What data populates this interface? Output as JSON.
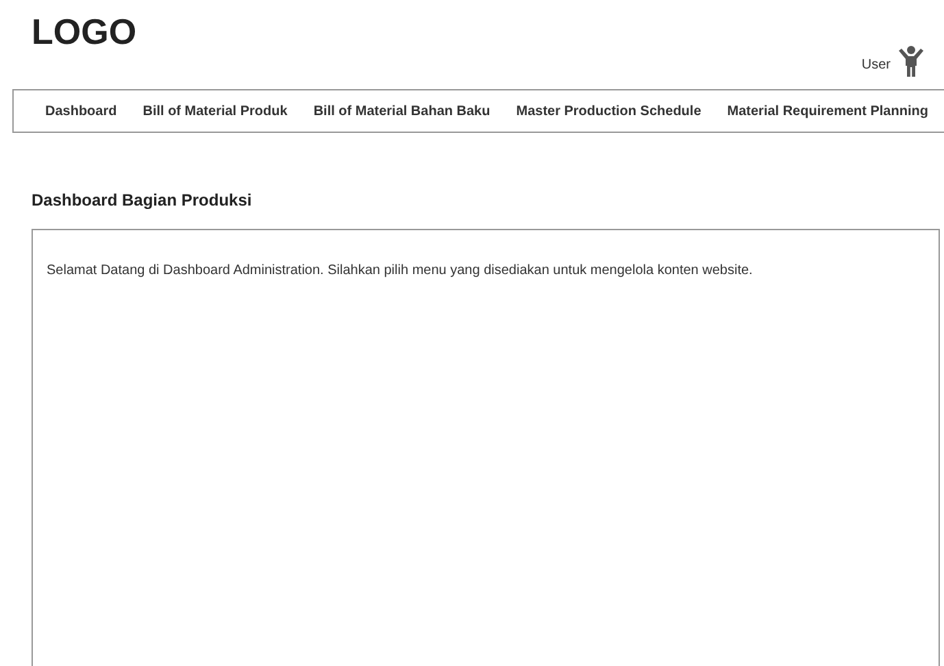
{
  "header": {
    "logo": "LOGO",
    "user": "User"
  },
  "nav": [
    "Dashboard",
    "Bill of Material Produk",
    "Bill of Material Bahan Baku",
    "Master Production Schedule",
    "Material Requirement Planning"
  ],
  "page_title": "Dashboard Bagian Produksi",
  "content": {
    "message": "Selamat Datang di Dashboard Administration. Silahkan pilih menu yang disediakan untuk mengelola konten website."
  }
}
